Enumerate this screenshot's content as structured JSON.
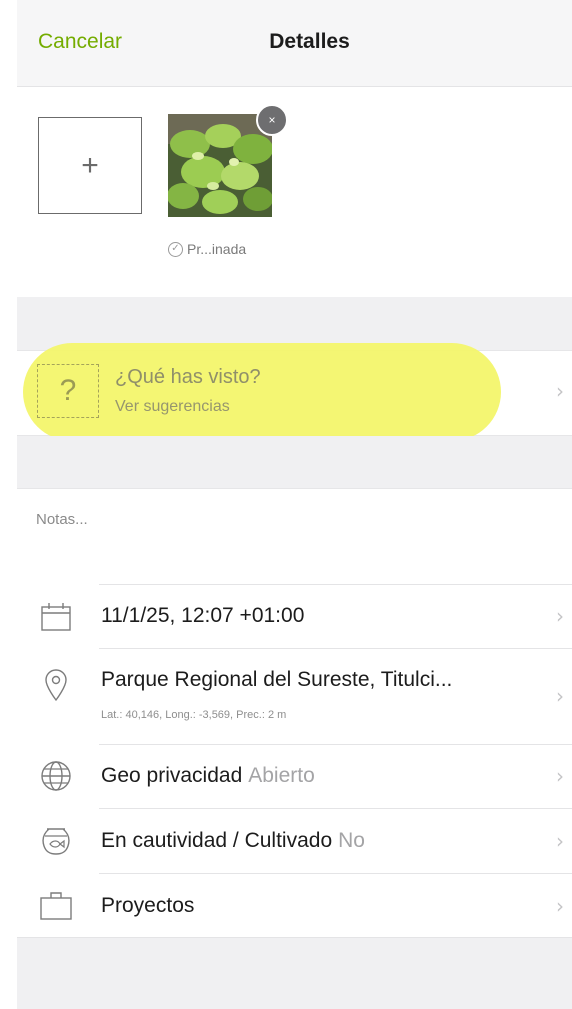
{
  "navbar": {
    "cancel_label": "Cancelar",
    "title": "Detalles"
  },
  "photos": {
    "add_symbol": "+",
    "remove_symbol": "×",
    "status_label": "Pr...inada"
  },
  "taxon": {
    "title": "¿Qué has visto?",
    "subtitle": "Ver sugerencias",
    "icon_symbol": "?"
  },
  "notes": {
    "placeholder": "Notas..."
  },
  "rows": {
    "date": {
      "label": "11/1/25, 12:07 +01:00"
    },
    "location": {
      "label": "Parque Regional del Sureste, Titulci...",
      "coords": "Lat.: 40,146, Long.: -3,569, Prec.: 2 m"
    },
    "geoprivacy": {
      "label": "Geo privacidad",
      "value": "Abierto"
    },
    "captive": {
      "label": "En cautividad / Cultivado",
      "value": "No"
    },
    "projects": {
      "label": "Proyectos"
    }
  },
  "chevron": "›",
  "colors": {
    "accent": "#74ac00",
    "highlight": "#f3f56b"
  }
}
